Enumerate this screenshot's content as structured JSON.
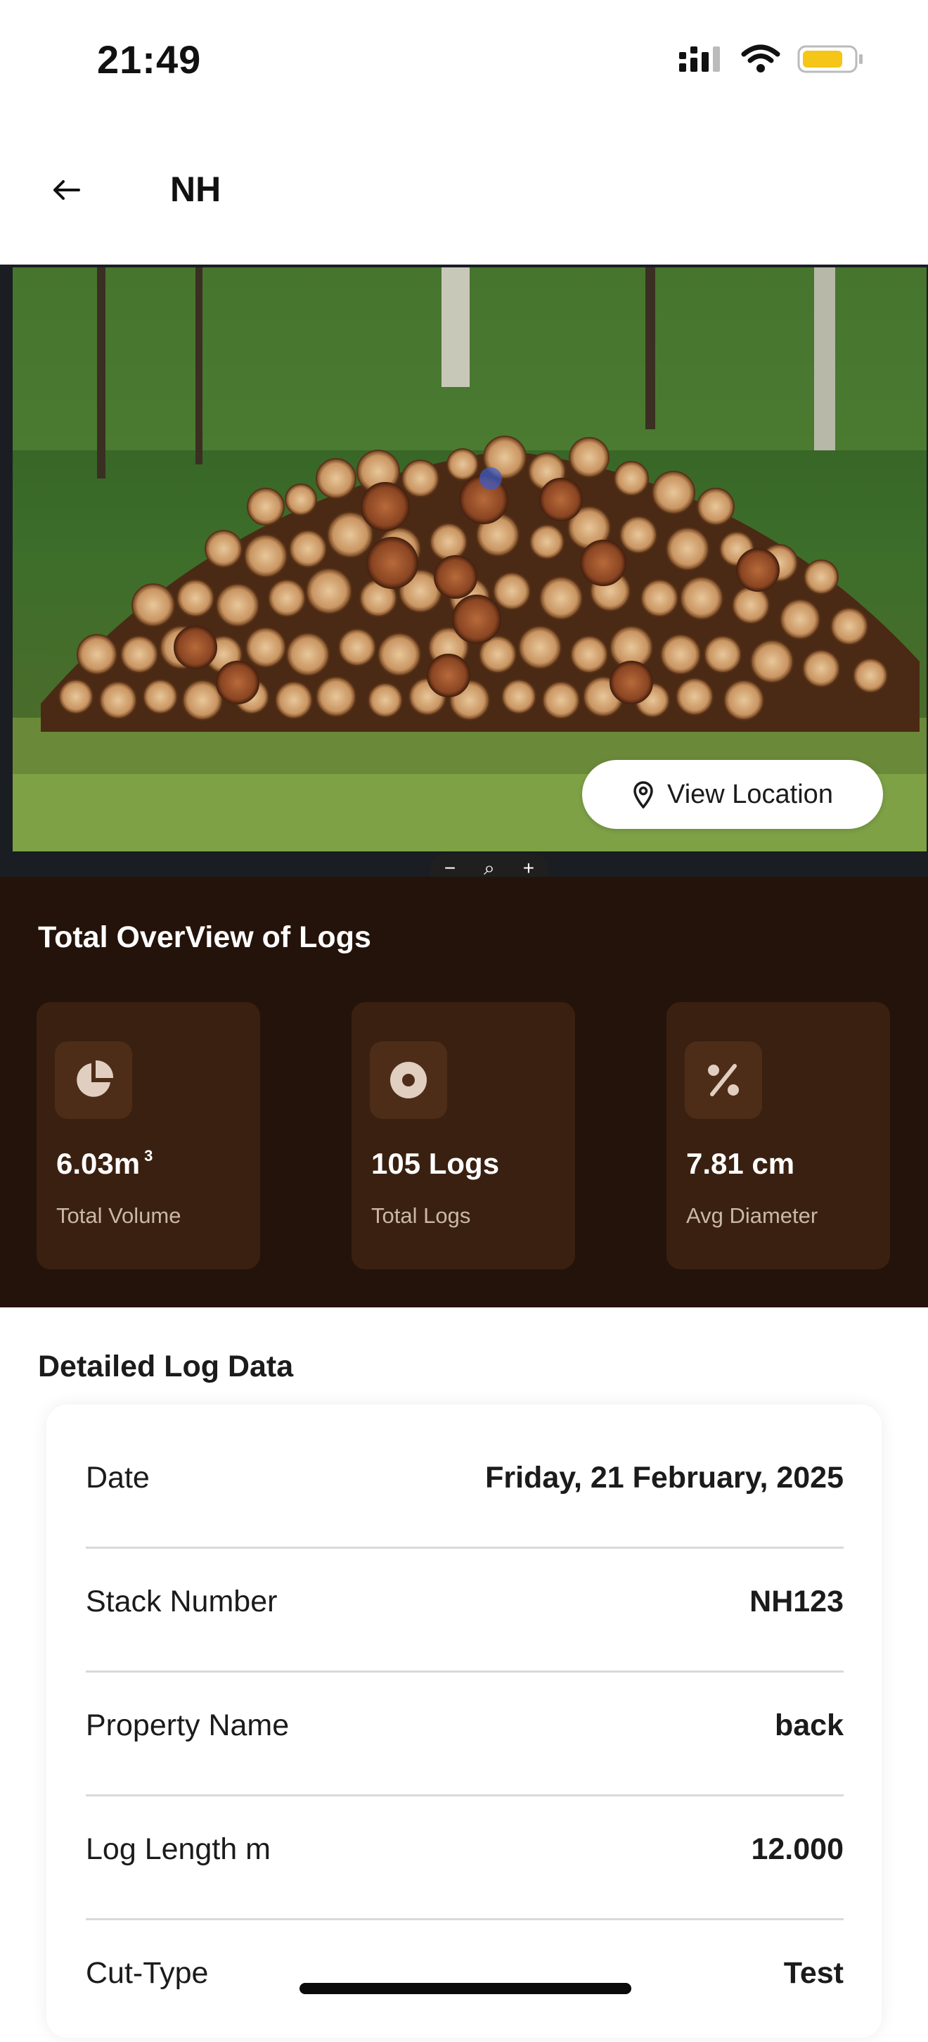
{
  "status_bar": {
    "time": "21:49"
  },
  "header": {
    "title": "NH"
  },
  "hero": {
    "view_location_label": "View Location",
    "map_controls": [
      "−",
      "⌕",
      "+"
    ]
  },
  "overview": {
    "title": "Total OverView of Logs",
    "stats": [
      {
        "icon": "pie-chart-icon",
        "value": "6.03m",
        "superscript": "3",
        "label": "Total Volume"
      },
      {
        "icon": "log-icon",
        "value": "105 Logs",
        "label": "Total Logs"
      },
      {
        "icon": "percent-icon",
        "value": "7.81 cm",
        "label": "Avg Diameter"
      }
    ]
  },
  "details": {
    "title": "Detailed Log Data",
    "rows": [
      {
        "label": "Date",
        "value": "Friday, 21 February, 2025"
      },
      {
        "label": "Stack Number",
        "value": "NH123"
      },
      {
        "label": "Property Name",
        "value": "back"
      },
      {
        "label": "Log Length m",
        "value": "12.000"
      },
      {
        "label": "Cut-Type",
        "value": "Test"
      }
    ]
  },
  "colors": {
    "overview_bg": "#24130a",
    "card_bg": "#3a2010",
    "icon_bg": "#4e2d18",
    "battery": "#f5c518"
  }
}
